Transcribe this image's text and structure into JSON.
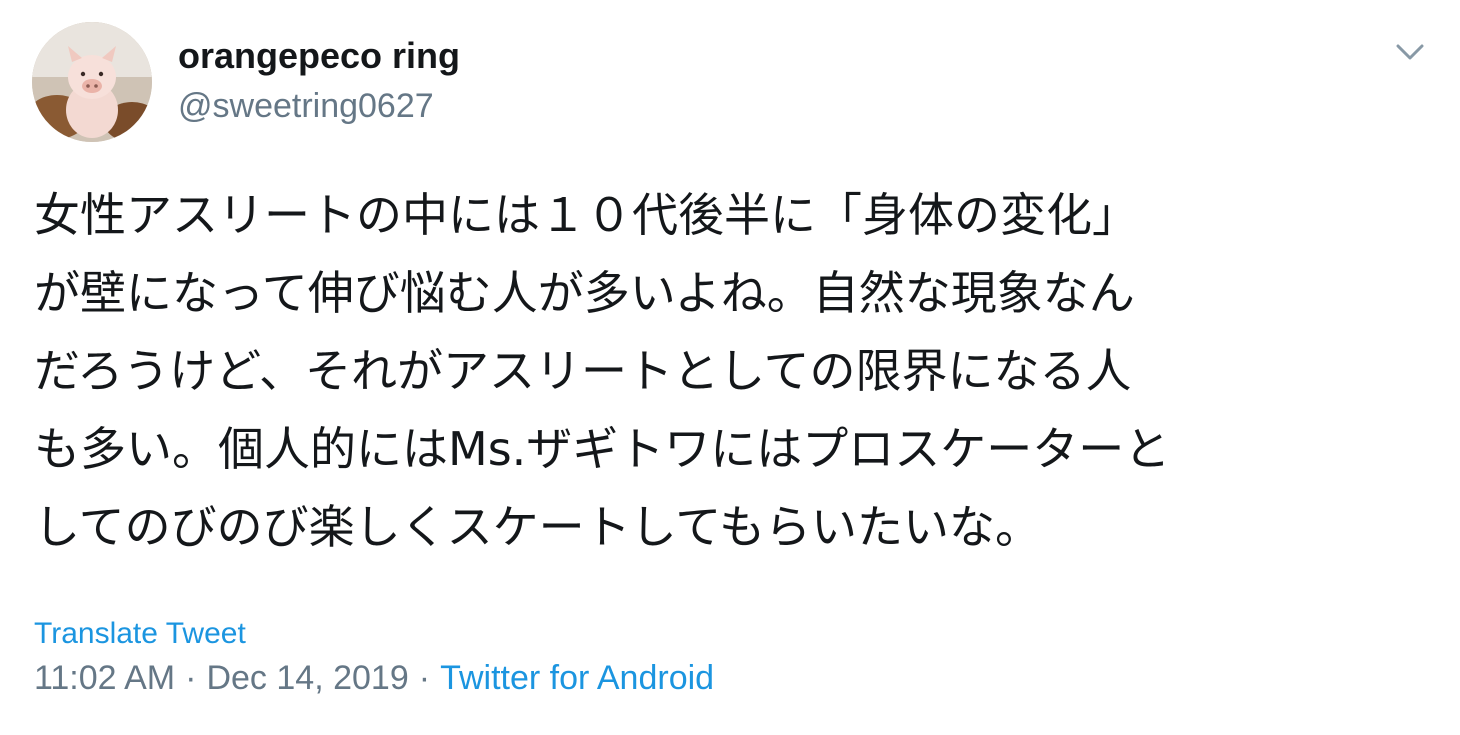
{
  "tweet": {
    "author": {
      "display_name": "orangepeco ring",
      "handle": "@sweetring0627"
    },
    "text_lines": [
      "女性アスリートの中には１０代後半に「身体の変化」",
      "が壁になって伸び悩む人が多いよね。自然な現象なん",
      "だろうけど、それがアスリートとしての限界になる人",
      "も多い。個人的にはMs.ザギトワにはプロスケーターと",
      "してのびのび楽しくスケートしてもらいたいな。"
    ],
    "translate_label": "Translate Tweet",
    "time": "11:02 AM",
    "separator": "·",
    "date": "Dec 14, 2019",
    "source": "Twitter for Android"
  },
  "icons": {
    "avatar": "piglet-avatar-photo",
    "caret": "chevron-down-icon"
  },
  "colors": {
    "text": "#14171a",
    "secondary": "#657786",
    "link": "#1b95e0"
  }
}
